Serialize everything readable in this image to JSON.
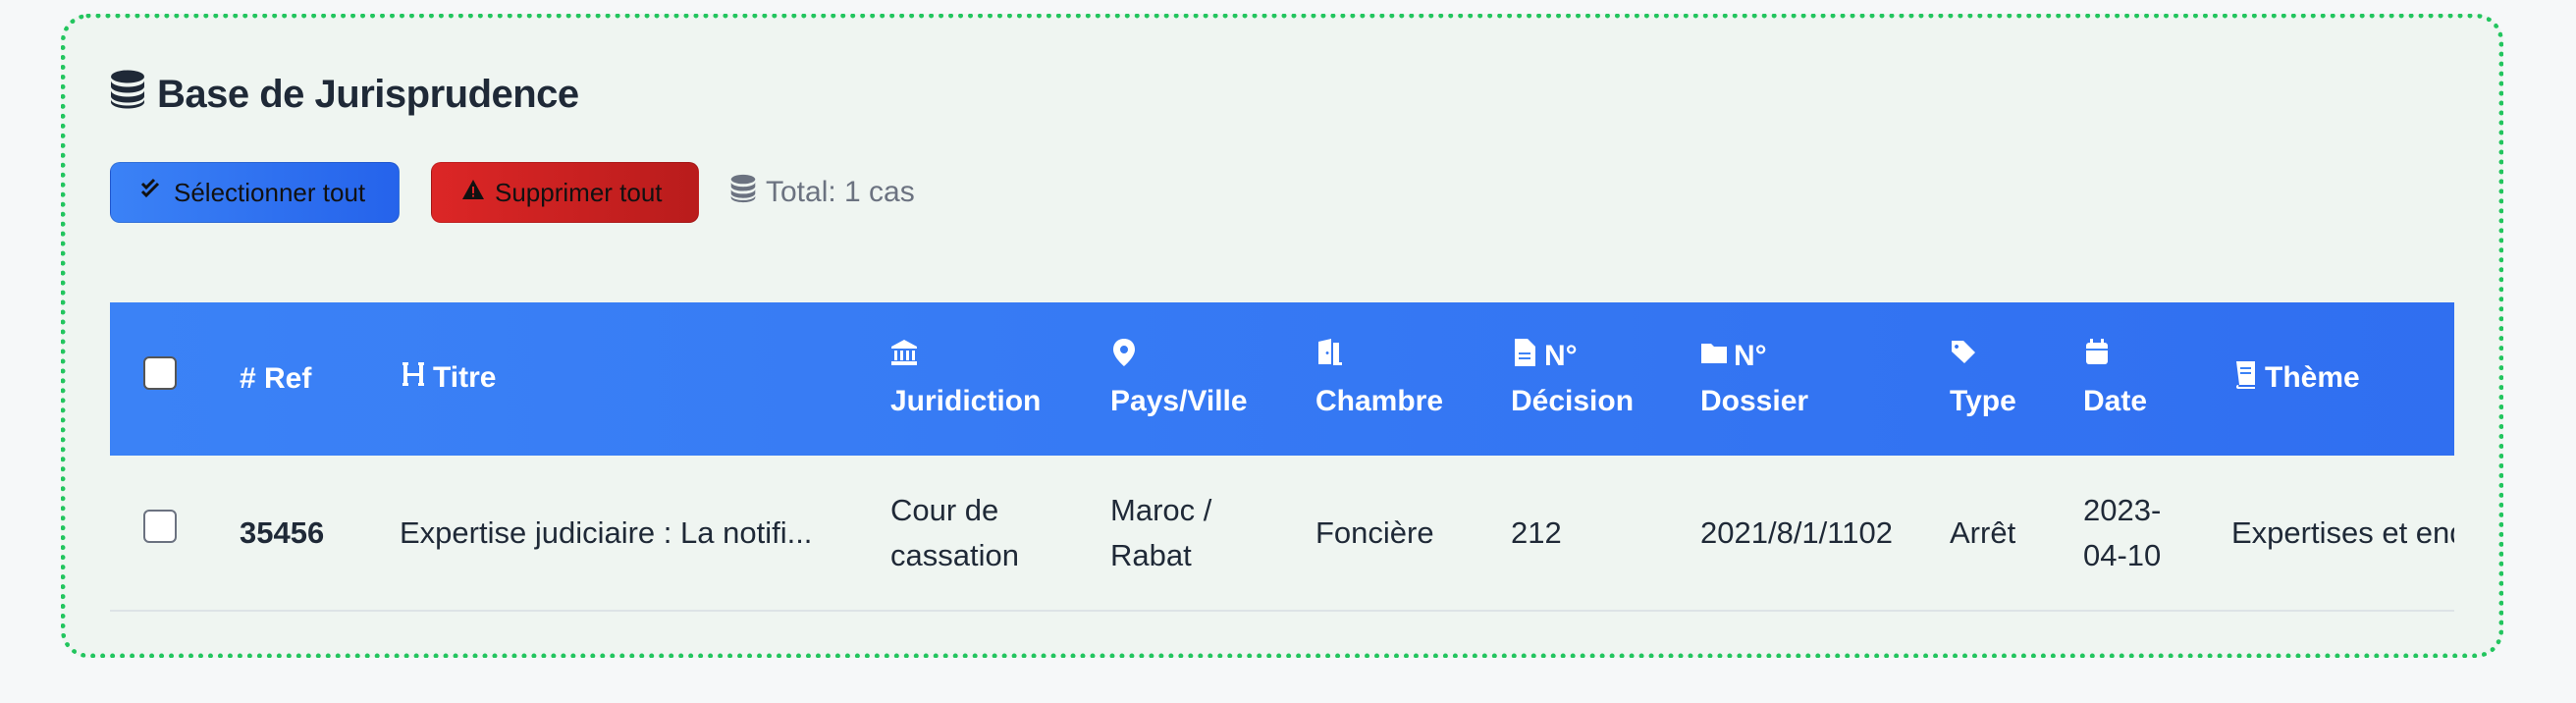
{
  "header": {
    "title": "Base de Jurisprudence"
  },
  "toolbar": {
    "select_all_label": "Sélectionner tout",
    "delete_all_label": "Supprimer tout",
    "total_label": "Total: 1 cas"
  },
  "table": {
    "columns": [
      {
        "line1": "# Ref",
        "line2": ""
      },
      {
        "line1": "Titre",
        "line2": ""
      },
      {
        "line1": "",
        "line2": "Juridiction"
      },
      {
        "line1": "",
        "line2": "Pays/Ville"
      },
      {
        "line1": "",
        "line2": "Chambre"
      },
      {
        "line1": "N°",
        "line2": "Décision"
      },
      {
        "line1": "N°",
        "line2": "Dossier"
      },
      {
        "line1": "",
        "line2": "Type"
      },
      {
        "line1": "",
        "line2": "Date"
      },
      {
        "line1": "Thème",
        "line2": ""
      }
    ],
    "rows": [
      {
        "ref": "35456",
        "titre": "Expertise judiciaire : La notifi...",
        "juridiction_1": "Cour de",
        "juridiction_2": "cassation",
        "ville_1": "Maroc /",
        "ville_2": "Rabat",
        "chambre": "Foncière",
        "decision": "212",
        "dossier": "2021/8/1/1102",
        "type": "Arrêt",
        "date_1": "2023-",
        "date_2": "04-10",
        "theme": "Expertises et enquêtes"
      }
    ]
  },
  "colors": {
    "accent": "#3b82f6",
    "danger": "#dc2626",
    "border": "#22c55e"
  }
}
